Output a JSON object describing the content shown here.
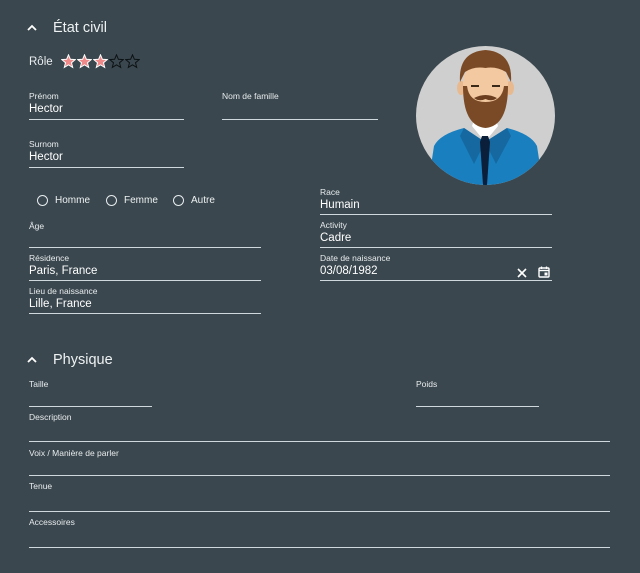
{
  "etat_civil": {
    "title": "État civil",
    "role_label": "Rôle",
    "role_rating": 3,
    "role_max": 5,
    "star_fill": "#f08a8a",
    "prenom": {
      "label": "Prénom",
      "value": "Hector"
    },
    "nom": {
      "label": "Nom de famille",
      "value": ""
    },
    "surnom": {
      "label": "Surnom",
      "value": "Hector"
    },
    "genre": {
      "options": [
        "Homme",
        "Femme",
        "Autre"
      ]
    },
    "age": {
      "label": "Âge",
      "value": ""
    },
    "residence": {
      "label": "Résidence",
      "value": "Paris, France"
    },
    "lieu": {
      "label": "Lieu de naissance",
      "value": "Lille, France"
    },
    "race": {
      "label": "Race",
      "value": "Humain"
    },
    "activity": {
      "label": "Activity",
      "value": "Cadre"
    },
    "naissance": {
      "label": "Date de naissance",
      "value": "03/08/1982"
    }
  },
  "physique": {
    "title": "Physique",
    "taille": {
      "label": "Taille",
      "value": ""
    },
    "poids": {
      "label": "Poids",
      "value": ""
    },
    "description": {
      "label": "Description",
      "value": ""
    },
    "voix": {
      "label": "Voix / Manière de parler",
      "value": ""
    },
    "tenue": {
      "label": "Tenue",
      "value": ""
    },
    "accessoires": {
      "label": "Accessoires",
      "value": ""
    }
  },
  "colors": {
    "background": "#3a474e",
    "underline": "#cfd8dc",
    "star": "#f08a8a"
  }
}
